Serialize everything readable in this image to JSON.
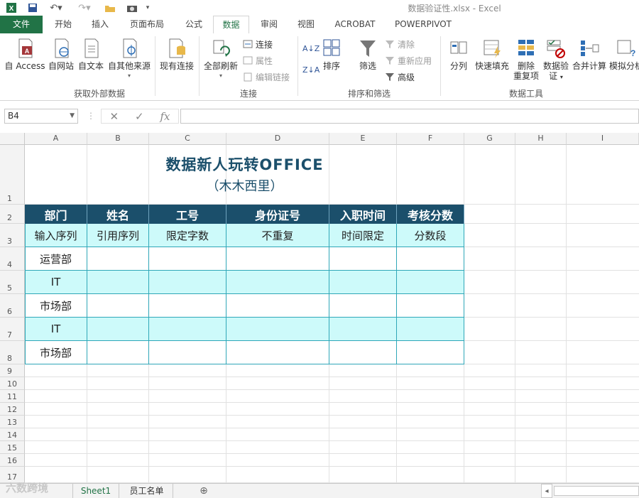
{
  "window": {
    "title": "数据验证性.xlsx - Excel"
  },
  "qat": {
    "save_icon": "save-icon",
    "undo_icon": "undo-icon",
    "redo_icon": "redo-icon",
    "open_icon": "folder-icon",
    "camera_icon": "camera-icon"
  },
  "tabs": [
    {
      "label": "文件"
    },
    {
      "label": "开始"
    },
    {
      "label": "插入"
    },
    {
      "label": "页面布局"
    },
    {
      "label": "公式"
    },
    {
      "label": "数据"
    },
    {
      "label": "审阅"
    },
    {
      "label": "视图"
    },
    {
      "label": "ACROBAT"
    },
    {
      "label": "POWERPIVOT"
    }
  ],
  "ribbon": {
    "external": {
      "access": "自 Access",
      "web": "自网站",
      "text": "自文本",
      "other": "自其他来源",
      "existing": "现有连接",
      "group": "获取外部数据"
    },
    "connections": {
      "refresh": "全部刷新",
      "conn": "连接",
      "props": "属性",
      "edit_links": "编辑链接",
      "group": "连接"
    },
    "sort": {
      "sort": "排序",
      "filter": "筛选",
      "clear": "清除",
      "reapply": "重新应用",
      "advanced": "高级",
      "group": "排序和筛选"
    },
    "tools": {
      "split": "分列",
      "flash": "快速填充",
      "remove_dup_1": "删除",
      "remove_dup_2": "重复项",
      "validate_1": "数据验",
      "validate_2": "证",
      "consolidate": "合并计算",
      "whatif": "模拟分析",
      "group": "数据工具"
    }
  },
  "formula_bar": {
    "name_box": "B4",
    "value": ""
  },
  "grid": {
    "columns": [
      "A",
      "B",
      "C",
      "D",
      "E",
      "F",
      "G",
      "H",
      "I"
    ],
    "rows": [
      "1",
      "2",
      "3",
      "4",
      "5",
      "6",
      "7",
      "8",
      "9",
      "10",
      "11",
      "12",
      "13",
      "14",
      "15",
      "16",
      "17"
    ]
  },
  "sheet": {
    "title": "数据新人玩转OFFICE",
    "subtitle": "（木木西里）",
    "headers": [
      "部门",
      "姓名",
      "工号",
      "身份证号",
      "入职时间",
      "考核分数"
    ],
    "rules": [
      "输入序列",
      "引用序列",
      "限定字数",
      "不重复",
      "时间限定",
      "分数段"
    ],
    "departments": [
      "运营部",
      "IT",
      "市场部",
      "IT",
      "市场部"
    ]
  },
  "sheet_tabs": [
    {
      "label": "Sheet1"
    },
    {
      "label": "员工名单"
    }
  ],
  "watermark": "六数跨境",
  "colors": {
    "excel_green": "#217346",
    "header_fill": "#1b4f6b",
    "band_fill": "#cdfafa",
    "border": "#2fa7b8"
  }
}
